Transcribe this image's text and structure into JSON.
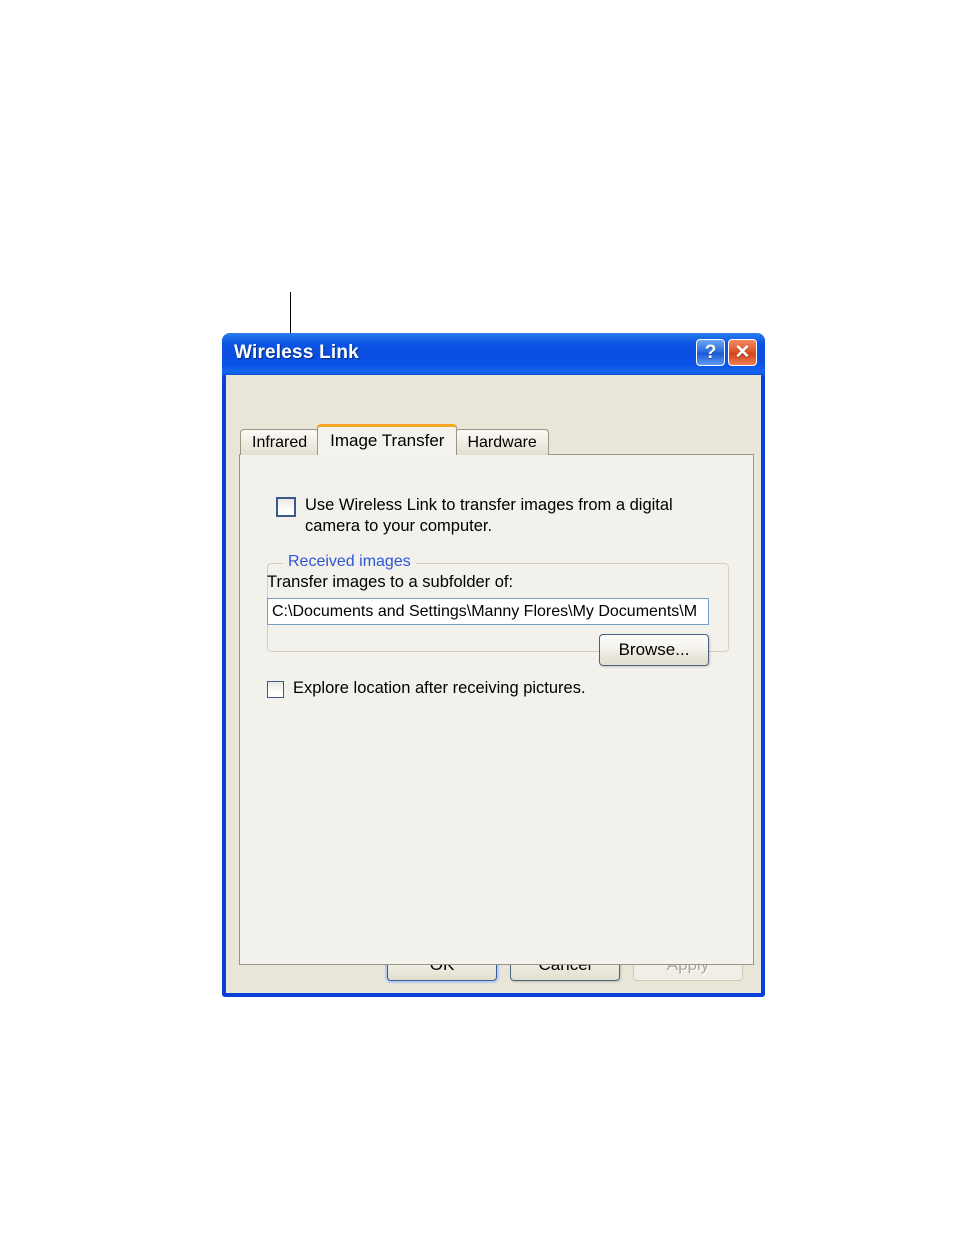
{
  "dialog": {
    "title": "Wireless Link",
    "titlebar_buttons": [
      {
        "name": "help-button",
        "glyph": "?"
      },
      {
        "name": "close-button",
        "glyph": "✕"
      }
    ],
    "tabs": [
      {
        "label": "Infrared",
        "active": false
      },
      {
        "label": "Image Transfer",
        "active": true
      },
      {
        "label": "Hardware",
        "active": false
      }
    ],
    "use_wireless_link": {
      "label": "Use Wireless Link to transfer images from a digital camera to your computer.",
      "checked": false
    },
    "received_images_group": {
      "title": "Received images",
      "transfer_label": "Transfer images to a subfolder of:",
      "path_value": "C:\\Documents and Settings\\Manny Flores\\My Documents\\M",
      "path_placeholder": "",
      "browse_label": "Browse...",
      "explore_label": "Explore location after receiving pictures.",
      "explore_checked": false
    },
    "footer": {
      "ok_label": "OK",
      "cancel_label": "Cancel",
      "apply_label": "Apply",
      "apply_enabled": false
    },
    "colors": {
      "titlebar_blue": "#0a4ee2",
      "border_blue": "#0a3fd8",
      "active_tab_accent": "#f5a623",
      "group_label_blue": "#2d56d6",
      "close_button_red": "#e2552a",
      "dialog_background": "#e9e5d8",
      "panel_background": "#f2f1eb"
    }
  },
  "annotation": {
    "leader_line": "callout pointing to the Use Wireless Link checkbox"
  }
}
